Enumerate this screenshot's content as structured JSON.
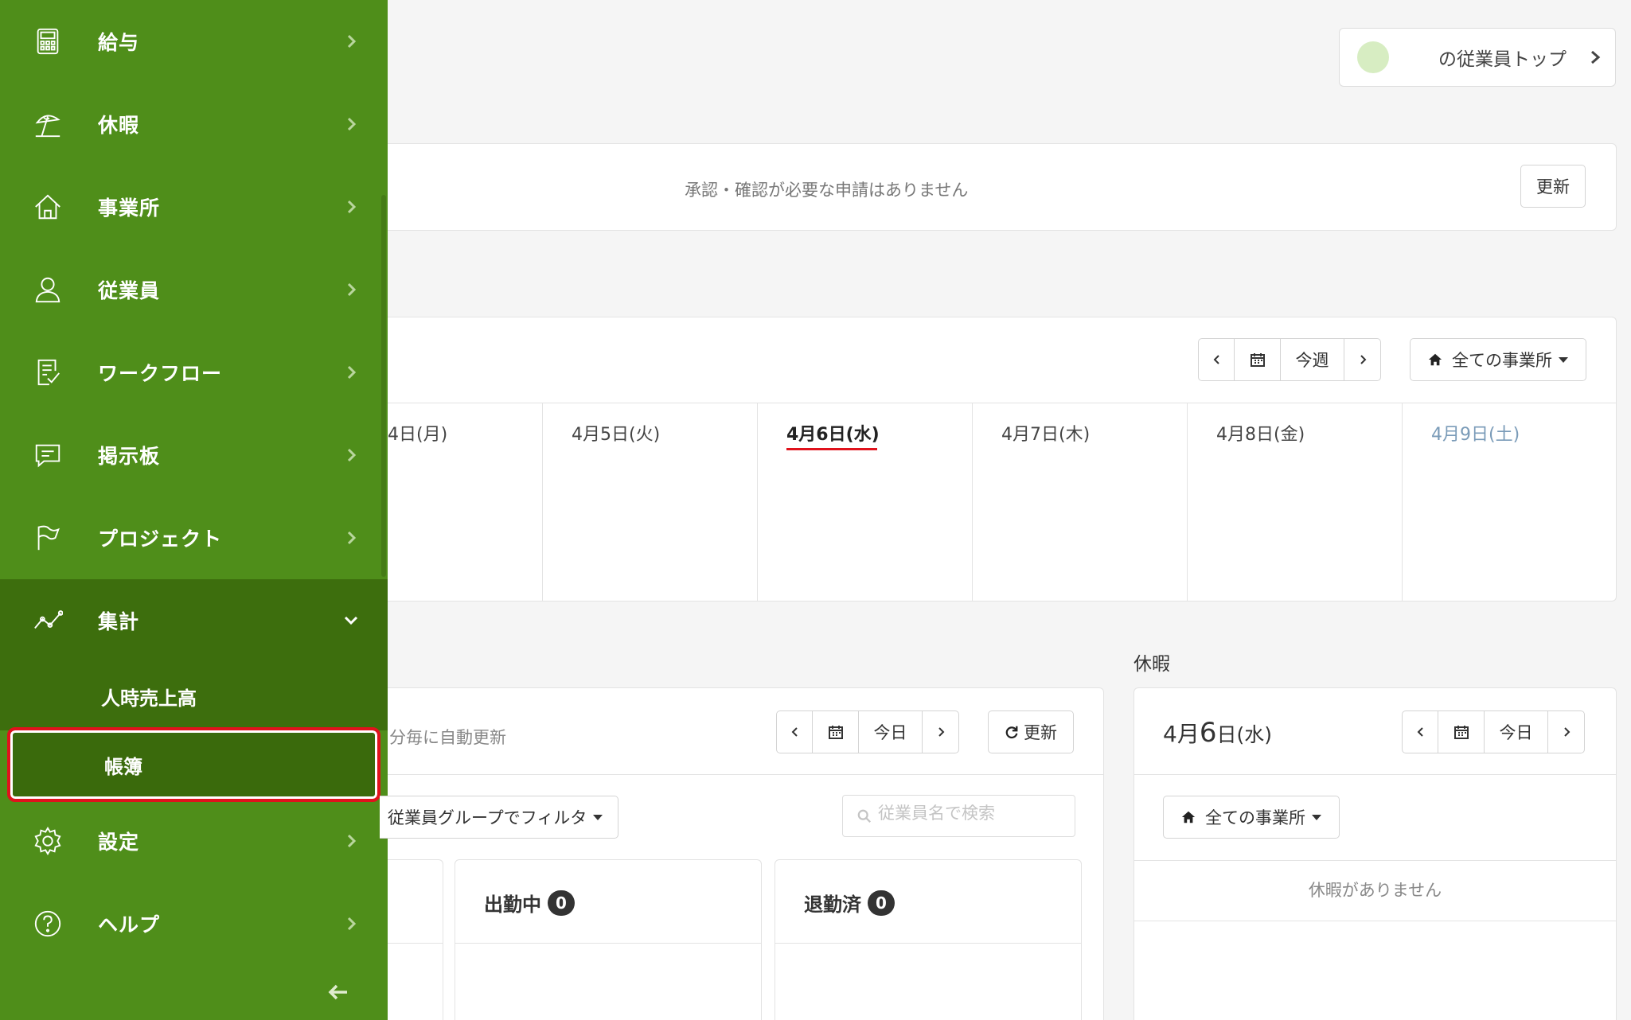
{
  "sidebar": {
    "items": [
      {
        "label": "給与",
        "icon": "calculator-icon"
      },
      {
        "label": "休暇",
        "icon": "beach-umbrella-icon"
      },
      {
        "label": "事業所",
        "icon": "home-icon"
      },
      {
        "label": "従業員",
        "icon": "person-icon"
      },
      {
        "label": "ワークフロー",
        "icon": "checklist-icon"
      },
      {
        "label": "掲示板",
        "icon": "chat-icon"
      },
      {
        "label": "プロジェクト",
        "icon": "flag-icon"
      },
      {
        "label": "集計",
        "icon": "line-chart-icon"
      },
      {
        "label": "設定",
        "icon": "gear-icon"
      },
      {
        "label": "ヘルプ",
        "icon": "help-circle-icon"
      }
    ],
    "subitems": [
      {
        "label": "人時売上高"
      },
      {
        "label": "帳簿"
      }
    ]
  },
  "header": {
    "top_link_label": "の従業員トップ"
  },
  "approvals": {
    "message": "承認・確認が必要な申請はありません",
    "refresh_label": "更新"
  },
  "schedule": {
    "this_week_label": "今週",
    "office_filter_label": "全ての事業所",
    "days": [
      "4日(月)",
      "4月5日(火)",
      "4月6日(水)",
      "4月7日(木)",
      "4月8日(金)",
      "4月9日(土)"
    ]
  },
  "attendance": {
    "auto_refresh_text": "分毎に自動更新",
    "today_label": "今日",
    "refresh_label": "更新",
    "group_filter_label": "従業員グループでフィルタ",
    "search_placeholder": "従業員名で検索",
    "working_label": "出勤中",
    "working_count": "0",
    "left_label": "退勤済",
    "left_count": "0"
  },
  "vacation": {
    "section_title": "休暇",
    "date_month": "4月",
    "date_day": "6",
    "date_suffix": "日(水)",
    "today_label": "今日",
    "office_filter_label": "全ての事業所",
    "empty_message": "休暇がありません"
  },
  "colors": {
    "sidebar_bg": "#4f8e1a",
    "sidebar_active_bg": "#3d6e0d",
    "highlight_red": "#e0121c"
  }
}
